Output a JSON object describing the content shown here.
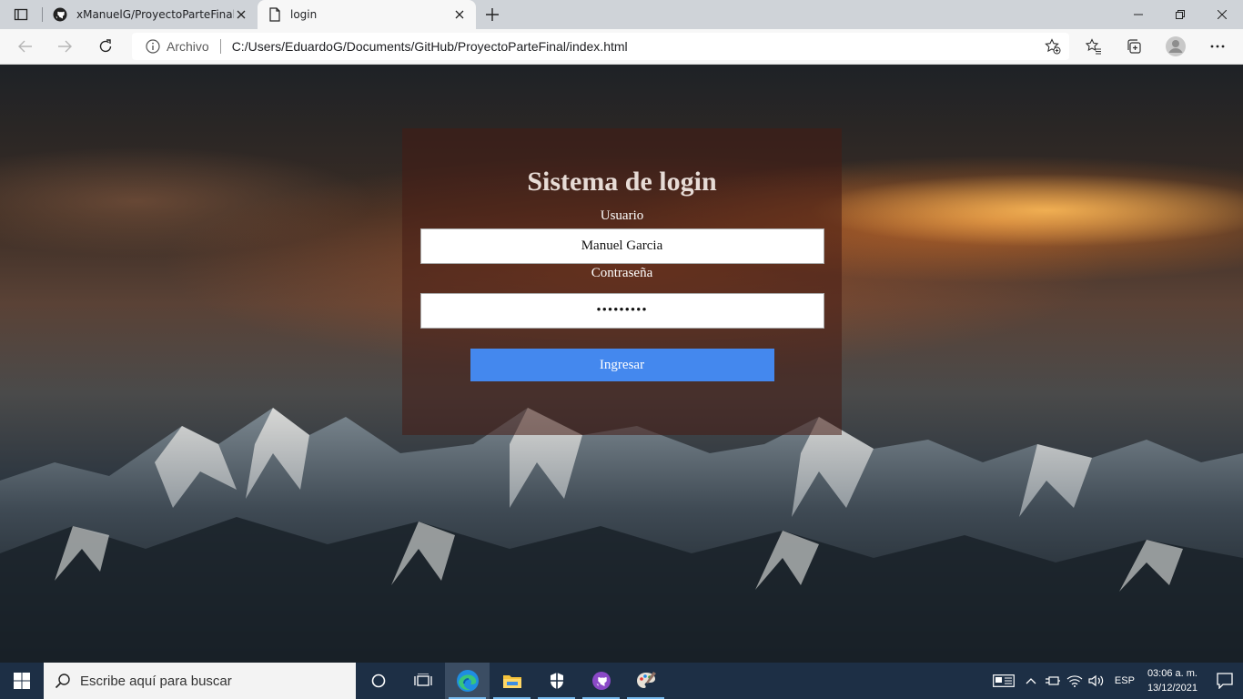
{
  "browser": {
    "tabs": [
      {
        "title": "xManuelG/ProyectoParteFinal: Co",
        "icon": "github-icon"
      },
      {
        "title": "login",
        "icon": "page-icon"
      }
    ],
    "address": {
      "security_label": "Archivo",
      "url": "C:/Users/EduardoG/Documents/GitHub/ProyectoParteFinal/index.html"
    }
  },
  "login": {
    "title": "Sistema de login",
    "user_label": "Usuario",
    "user_value": "Manuel Garcia",
    "password_label": "Contraseña",
    "password_value": "•••••••••",
    "submit_label": "Ingresar",
    "button_color": "#4488ee"
  },
  "taskbar": {
    "search_placeholder": "Escribe aquí para buscar",
    "language": "ESP",
    "time": "03:06 a. m.",
    "date": "13/12/2021"
  }
}
